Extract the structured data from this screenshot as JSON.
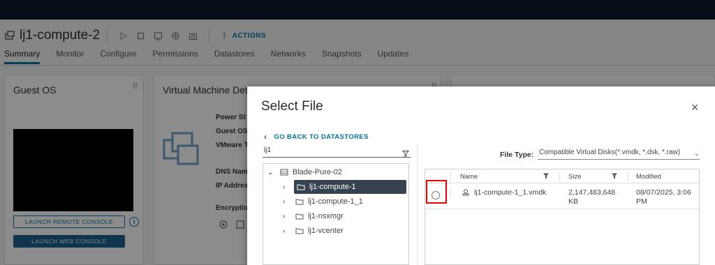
{
  "vm": {
    "title": "lj1-compute-2",
    "actions_label": "ACTIONS"
  },
  "tabs": [
    "Summary",
    "Monitor",
    "Configure",
    "Permissions",
    "Datastores",
    "Networks",
    "Snapshots",
    "Updates"
  ],
  "cards": {
    "guest_os": {
      "title": "Guest OS",
      "launch_remote_console": "LAUNCH REMOTE CONSOLE",
      "launch_web_console": "LAUNCH WEB CONSOLE",
      "info_icon_glyph": "i"
    },
    "vm_details": {
      "title": "Virtual Machine Deta",
      "labels": [
        "Power St",
        "Guest OS",
        "VMware T",
        "DNS Nam",
        "IP Addres",
        "Encryptio"
      ]
    }
  },
  "modal": {
    "title": "Select File",
    "close_glyph": "×",
    "back_link": "GO BACK TO DATASTORES",
    "filter_value": "lj1",
    "tree": {
      "root": "Blade-Pure-02",
      "children": [
        "lj1-compute-1",
        "lj1-compute-1_1",
        "lj1-nsxmgr",
        "lj1-vcenter"
      ],
      "selected_index": 0
    },
    "file_type": {
      "label": "File Type:",
      "value": "Compatible Virtual Disks(*.vmdk, *.dsk, *.raw)"
    },
    "grid": {
      "columns": [
        "Name",
        "Size",
        "Modified"
      ],
      "rows": [
        {
          "name": "lj1-compute-1_1.vmdk",
          "size_line1": "2,147,483,648",
          "size_line2": "KB",
          "modified_line1": "08/07/2025, 3:06",
          "modified_line2": "PM"
        }
      ]
    }
  },
  "colors": {
    "accent": "#0072a3",
    "selected_tree": "#37424f",
    "highlight": "#e00000",
    "topbar": "#0d1b2a"
  }
}
